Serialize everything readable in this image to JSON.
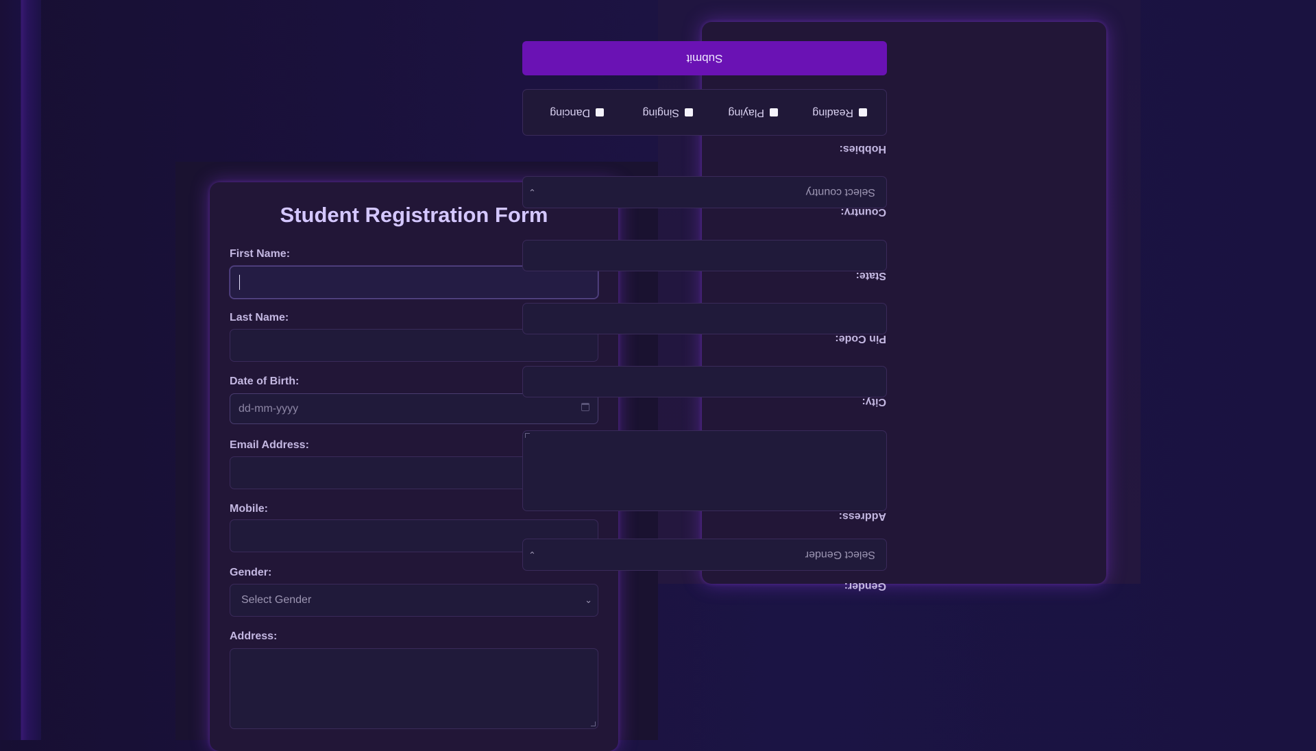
{
  "form": {
    "title": "Student Registration Form",
    "first_name": {
      "label": "First Name:",
      "value": ""
    },
    "last_name": {
      "label": "Last Name:",
      "value": ""
    },
    "dob": {
      "label": "Date of Birth:",
      "placeholder": "dd-mm-yyyy"
    },
    "email": {
      "label": "Email Address:",
      "value": ""
    },
    "mobile": {
      "label": "Mobile:",
      "value": ""
    },
    "gender": {
      "label": "Gender:",
      "selected": "Select Gender"
    },
    "address": {
      "label": "Address:",
      "value": ""
    }
  },
  "mirror": {
    "gender_label": "Gender:",
    "gender_selected": "Select Gender",
    "address_label": "Address:",
    "city_label": "City:",
    "pin_label": "Pin Code:",
    "state_label": "State:",
    "country_label": "Country:",
    "country_selected": "Select country",
    "hobbies_label": "Hobbies:",
    "hobbies": [
      "Reading",
      "Playing",
      "Singing",
      "Dancing"
    ],
    "submit": "Submit"
  },
  "colors": {
    "accent": "#6a12b4",
    "title": "#d4c7ff",
    "background": "#1c1240"
  }
}
